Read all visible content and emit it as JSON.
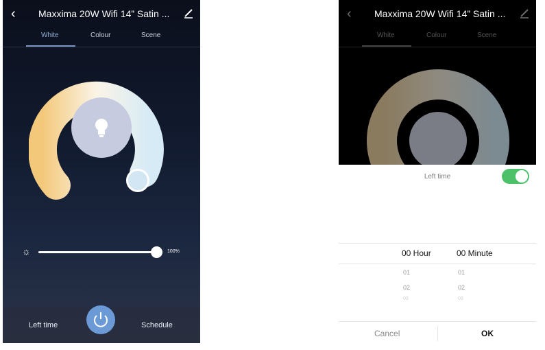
{
  "left": {
    "title": "Maxxima 20W Wifi 14” Satin ...",
    "tabs": [
      "White",
      "Colour",
      "Scene"
    ],
    "active_tab": "White",
    "brightness_percent": "100%",
    "brightness_level": 1.0,
    "left_time_label": "Left time",
    "schedule_label": "Schedule"
  },
  "right": {
    "title": "Maxxima 20W Wifi 14” Satin ...",
    "tabs": [
      "White",
      "Colour",
      "Scene"
    ],
    "left_time_label": "Left time",
    "toggle_on": true,
    "hour_selected": "00 Hour",
    "minute_selected": "00 Minute",
    "hour_options": [
      "01",
      "02",
      "03"
    ],
    "minute_options": [
      "01",
      "02",
      "03"
    ],
    "cancel_label": "Cancel",
    "ok_label": "OK"
  },
  "colors": {
    "accent_blue": "#6b9ad6",
    "toggle_green": "#4cc16a",
    "warm": "#f3c87a",
    "cool": "#dbeef8"
  },
  "icons": [
    "back-arrow-icon",
    "edit-icon",
    "bulb-icon",
    "sun-icon",
    "power-icon"
  ]
}
